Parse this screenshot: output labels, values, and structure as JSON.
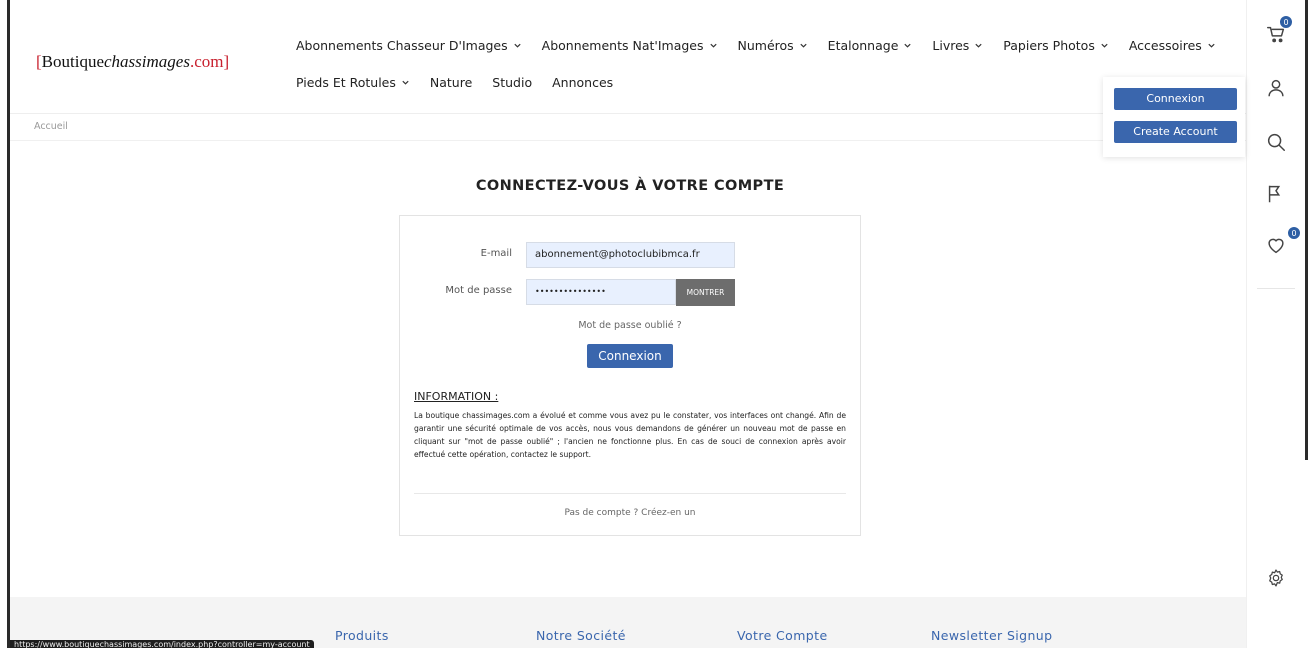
{
  "logo": {
    "open": "[",
    "brand": "Boutique",
    "italic": "chassimages",
    "domain": ".com]"
  },
  "nav": {
    "row1": [
      {
        "label": "Abonnements Chasseur D'Images",
        "dropdown": true
      },
      {
        "label": "Abonnements Nat'Images",
        "dropdown": true
      },
      {
        "label": "Numéros",
        "dropdown": true
      },
      {
        "label": "Etalonnage",
        "dropdown": true
      },
      {
        "label": "Livres",
        "dropdown": true
      },
      {
        "label": "Papiers Photos",
        "dropdown": true
      },
      {
        "label": "Accessoires",
        "dropdown": true
      }
    ],
    "row2": [
      {
        "label": "Pieds Et Rotules",
        "dropdown": true
      },
      {
        "label": "Nature",
        "dropdown": false
      },
      {
        "label": "Studio",
        "dropdown": false
      },
      {
        "label": "Annonces",
        "dropdown": false
      }
    ]
  },
  "breadcrumb": {
    "home": "Accueil"
  },
  "sidebar": {
    "cart_count": "0",
    "wishlist_count": "0"
  },
  "account_dropdown": {
    "login": "Connexion",
    "create": "Create Account"
  },
  "login": {
    "title": "CONNECTEZ-VOUS À VOTRE COMPTE",
    "email_label": "E-mail",
    "email_value": "abonnement@photoclubibmca.fr",
    "password_label": "Mot de passe",
    "password_value": "•••••••••••••••",
    "show_button": "MONTRER",
    "forgot": "Mot de passe oublié ?",
    "submit": "Connexion",
    "info_title": "INFORMATION :",
    "info_text": "La boutique chassimages.com a évolué et comme vous avez pu le constater, vos interfaces ont changé. Afin de garantir une sécurité optimale de vos accès, nous vous demandons de générer un nouveau mot de passe en cliquant sur \"mot de passe oublié\" ; l'ancien ne fonctionne plus. En cas de souci de connexion après avoir effectué cette opération, contactez le support.",
    "no_account": "Pas de compte ? Créez-en un"
  },
  "footer": {
    "products": "Produits",
    "company": "Notre Société",
    "account": "Votre Compte",
    "newsletter": "Newsletter Signup"
  },
  "status_url": "https://www.boutiquechassimages.com/index.php?controller=my-account",
  "colors": {
    "accent": "#3a66ad",
    "logo_red": "#c8202e"
  }
}
